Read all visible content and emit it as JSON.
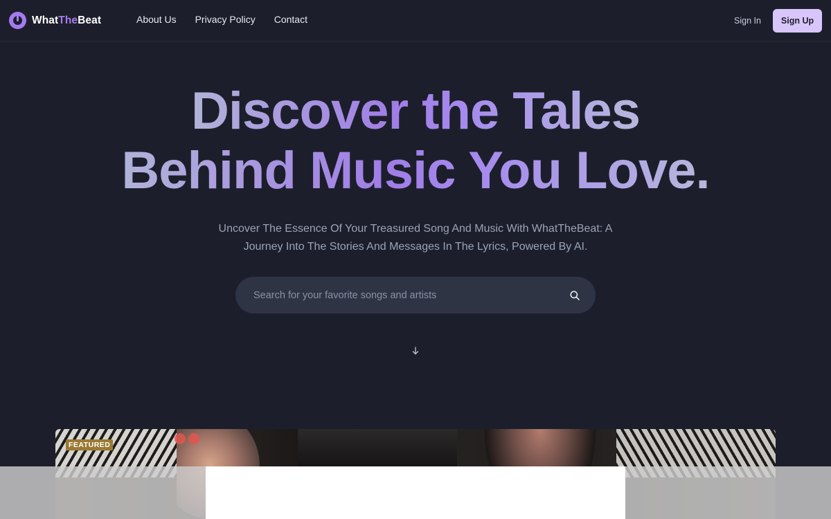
{
  "brand": {
    "name_part1": "What",
    "name_part2": "The",
    "name_part3": "Beat",
    "icon": "logo-icon"
  },
  "nav": {
    "links": [
      "About Us",
      "Privacy Policy",
      "Contact"
    ],
    "sign_in": "Sign In",
    "sign_up": "Sign Up"
  },
  "hero": {
    "title_line1": "Discover the Tales",
    "title_line2": "Behind Music You Love.",
    "subtitle": "Uncover The Essence Of Your Treasured Song And Music With WhatTheBeat: A Journey Into The Stories And Messages In The Lyrics, Powered By AI."
  },
  "search": {
    "placeholder": "Search for your favorite songs and artists",
    "value": "",
    "icon": "search-icon"
  },
  "scroll_icon": "arrow-down-icon",
  "featured": {
    "badge": "FEATURED"
  },
  "colors": {
    "background": "#1c1f2b",
    "accent": "#a57bf0",
    "signup_bg": "#d8c6fb",
    "search_bg": "#2e3444"
  }
}
